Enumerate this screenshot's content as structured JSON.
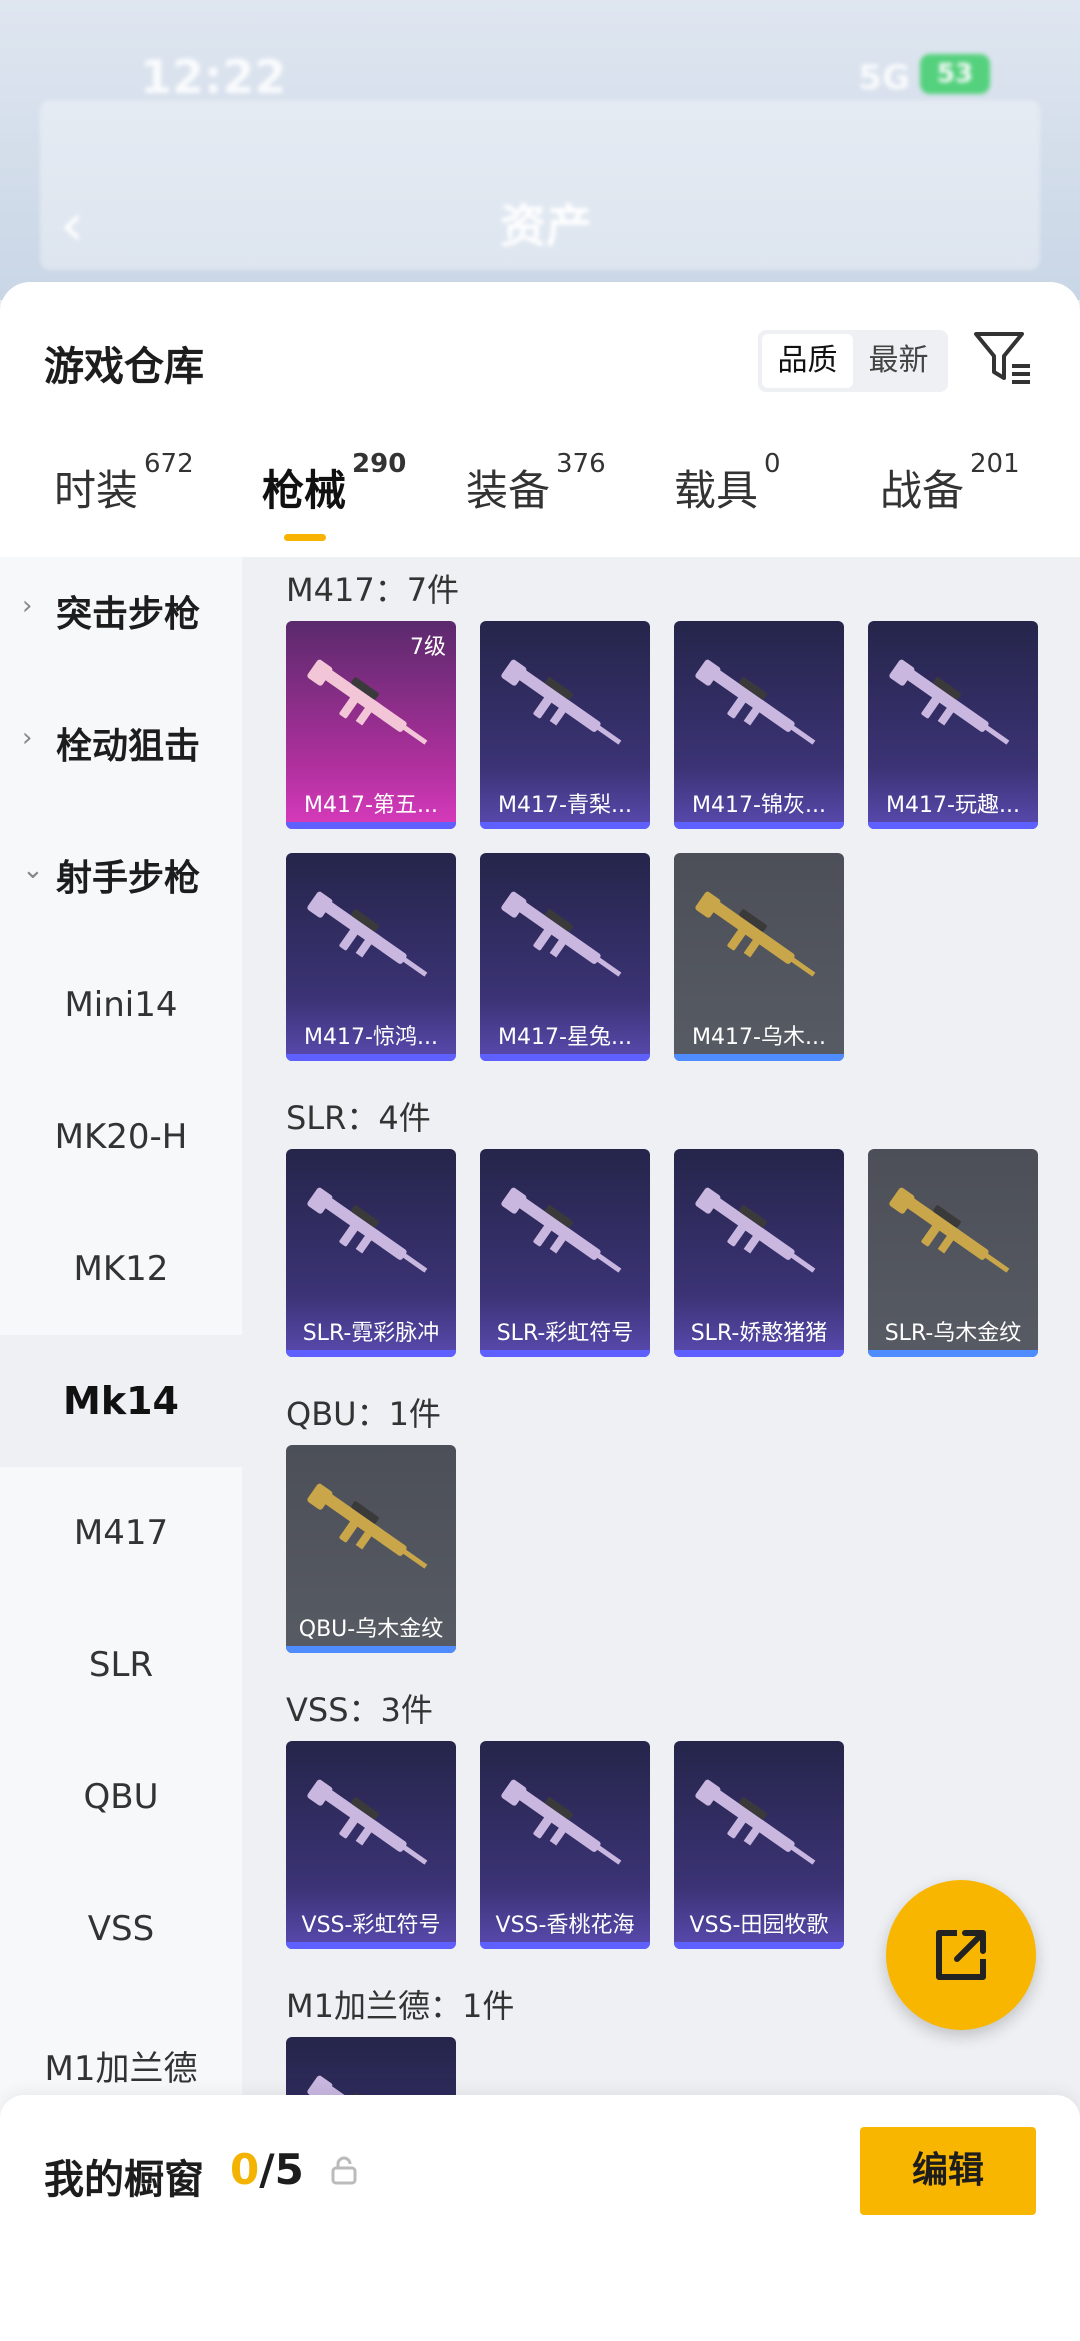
{
  "status": {
    "time": "12:22",
    "network": "5G",
    "battery": "53"
  },
  "appbar": {
    "title": "资产"
  },
  "sheet": {
    "title": "游戏仓库",
    "sort": [
      "品质",
      "最新"
    ],
    "sort_active": "品质"
  },
  "tabs": [
    {
      "label": "时装",
      "count": "672"
    },
    {
      "label": "枪械",
      "count": "290"
    },
    {
      "label": "装备",
      "count": "376"
    },
    {
      "label": "载具",
      "count": "0"
    },
    {
      "label": "战备",
      "count": "201"
    }
  ],
  "active_tab": "枪械",
  "sidebar": {
    "groups": [
      "突击步枪",
      "栓动狙击",
      "射手步枪"
    ],
    "items": [
      "Mini14",
      "MK20-H",
      "MK12",
      "Mk14",
      "M417",
      "SLR",
      "QBU",
      "VSS",
      "M1加兰德"
    ],
    "selected": "Mk14"
  },
  "sections": [
    {
      "title": "M417：7件",
      "items": [
        {
          "label": "M417-第五...",
          "level": "7级",
          "style": "pink"
        },
        {
          "label": "M417-青梨...",
          "style": "purple"
        },
        {
          "label": "M417-锦灰...",
          "style": "purple"
        },
        {
          "label": "M417-玩趣...",
          "style": "purple"
        },
        {
          "label": "M417-惊鸿...",
          "style": "purple"
        },
        {
          "label": "M417-星兔...",
          "style": "purple"
        },
        {
          "label": "M417-乌木...",
          "style": "gold"
        }
      ]
    },
    {
      "title": "SLR：4件",
      "items": [
        {
          "label": "SLR-霓彩脉冲",
          "style": "purple"
        },
        {
          "label": "SLR-彩虹符号",
          "style": "purple"
        },
        {
          "label": "SLR-娇憨猪猪",
          "style": "purple"
        },
        {
          "label": "SLR-乌木金纹",
          "style": "gold"
        }
      ]
    },
    {
      "title": "QBU：1件",
      "items": [
        {
          "label": "QBU-乌木金纹",
          "style": "gold"
        }
      ]
    },
    {
      "title": "VSS：3件",
      "items": [
        {
          "label": "VSS-彩虹符号",
          "style": "purple"
        },
        {
          "label": "VSS-香桃花海",
          "style": "purple"
        },
        {
          "label": "VSS-田园牧歌",
          "style": "purple"
        }
      ]
    },
    {
      "title": "M1加兰德：1件",
      "items": [
        {
          "label": "",
          "style": "purple"
        }
      ]
    }
  ],
  "showcase": {
    "title": "我的橱窗",
    "current": "0",
    "total": "/5"
  },
  "edit_button": "编辑",
  "colors": {
    "accent": "#f8b600",
    "card_purple": "#3b3375",
    "card_gold": "#575b63",
    "card_pink": "#b0309e"
  }
}
